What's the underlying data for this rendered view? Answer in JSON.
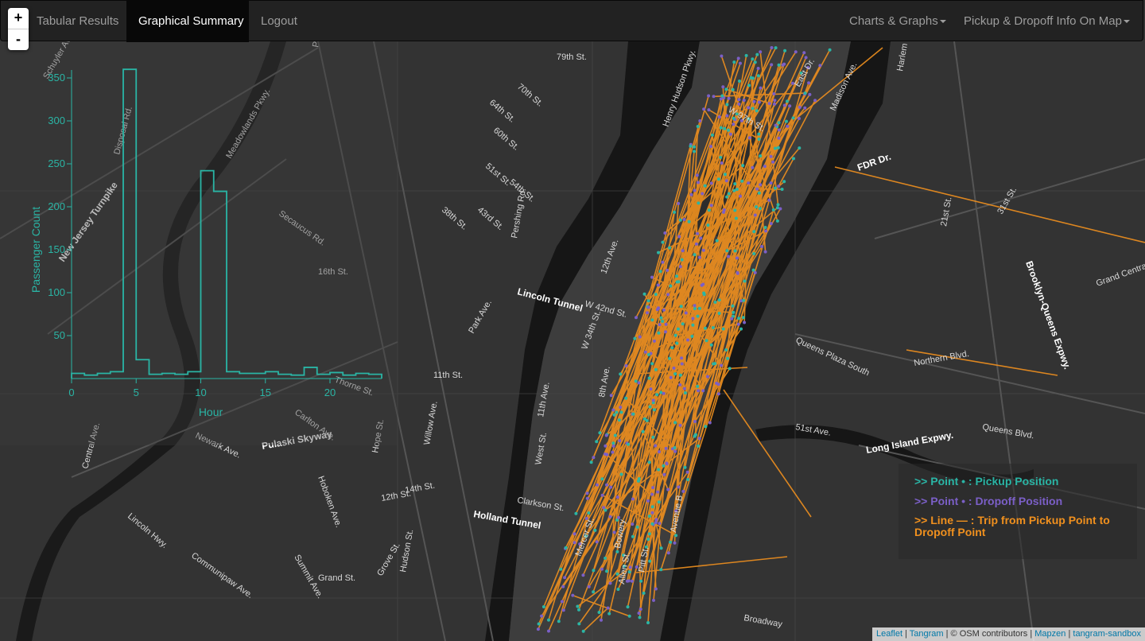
{
  "navbar": {
    "items": [
      {
        "label": "Tabular Results",
        "active": false
      },
      {
        "label": "Graphical Summary",
        "active": true
      },
      {
        "label": "Logout",
        "active": false
      }
    ],
    "right_items": [
      {
        "label": "Charts & Graphs"
      },
      {
        "label": "Pickup & Dropoff Info On Map"
      }
    ]
  },
  "zoom": {
    "in": "+",
    "out": "-"
  },
  "chart_data": {
    "type": "line",
    "title": "",
    "xlabel": "Hour",
    "ylabel": "Passenger Count",
    "xlim": [
      0,
      24
    ],
    "ylim": [
      0,
      160
    ],
    "xticks": [
      0,
      5,
      10,
      15,
      20
    ],
    "yticks": [
      50,
      100,
      150,
      200,
      250,
      300,
      350
    ],
    "series": [
      {
        "x": [
          0,
          1,
          2,
          3,
          4,
          5,
          6,
          7,
          8,
          9,
          10,
          11,
          12,
          13,
          14,
          15,
          16,
          17,
          18,
          19,
          20,
          21,
          22,
          23,
          24
        ],
        "values": [
          6,
          4,
          6,
          8,
          360,
          22,
          5,
          6,
          5,
          8,
          242,
          218,
          8,
          6,
          6,
          8,
          5,
          4,
          13,
          5,
          7,
          4,
          6,
          5,
          5
        ]
      }
    ],
    "color": "#2ab5a5"
  },
  "legend": {
    "pickup": ">> Point • : Pickup Position",
    "dropoff": ">> Point • : Dropoff Position",
    "line": ">> Line — : Trip from Pickup Point to Dropoff Point",
    "pickup_color": "#2ab5a5",
    "dropoff_color": "#7b5fc7",
    "line_color": "#f0901e"
  },
  "map_labels": [
    "Schuyler Ave.",
    "New Jersey Turnpike",
    "Disposal Rd.",
    "Meadowlands Pkwy.",
    "Paterson Plank Rd.",
    "Secaucus Rd.",
    "16th St.",
    "Newark Ave.",
    "Pulaski Skyway",
    "Central Ave.",
    "Lincoln Hwy.",
    "Communipaw Ave.",
    "Summit Ave.",
    "Hoboken Ave.",
    "Grand St.",
    "Grove St.",
    "Hudson St.",
    "Holland Tunnel",
    "Lincoln Tunnel",
    "Park Ave.",
    "79th St.",
    "70th St.",
    "64th St.",
    "60th St.",
    "54th St.",
    "51st St.",
    "43rd St.",
    "38th St.",
    "Henry Hudson Pkwy.",
    "W 97th St.",
    "East Dr.",
    "Madison Ave.",
    "FDR Dr.",
    "Harlem River Dr.",
    "12th Ave.",
    "W 42nd St.",
    "W 34th St.",
    "8th Ave.",
    "11th Ave.",
    "West St.",
    "Clarkson St.",
    "Mercer St.",
    "Bowery",
    "Avenue B",
    "Allen St.",
    "Pitt St.",
    "Broadway",
    "Queens Plaza South",
    "Northern Blvd.",
    "Queens Blvd.",
    "Long Island Expwy.",
    "51st Ave.",
    "Brooklyn-Queens Expwy.",
    "Grand Central",
    "31st St.",
    "21st St.",
    "Pershing Rd.",
    "12th St.",
    "14th St.",
    "11th St.",
    "Willow Ave.",
    "Hope St.",
    "Carlton Ave.",
    "Thorne St."
  ],
  "attribution": {
    "leaflet": "Leaflet",
    "sep1": " | ",
    "tangram": "Tangram",
    "sep2": " | © OSM contributors | ",
    "mapzen": "Mapzen",
    "sep3": " | ",
    "sandbox": "tangram-sandbox"
  }
}
